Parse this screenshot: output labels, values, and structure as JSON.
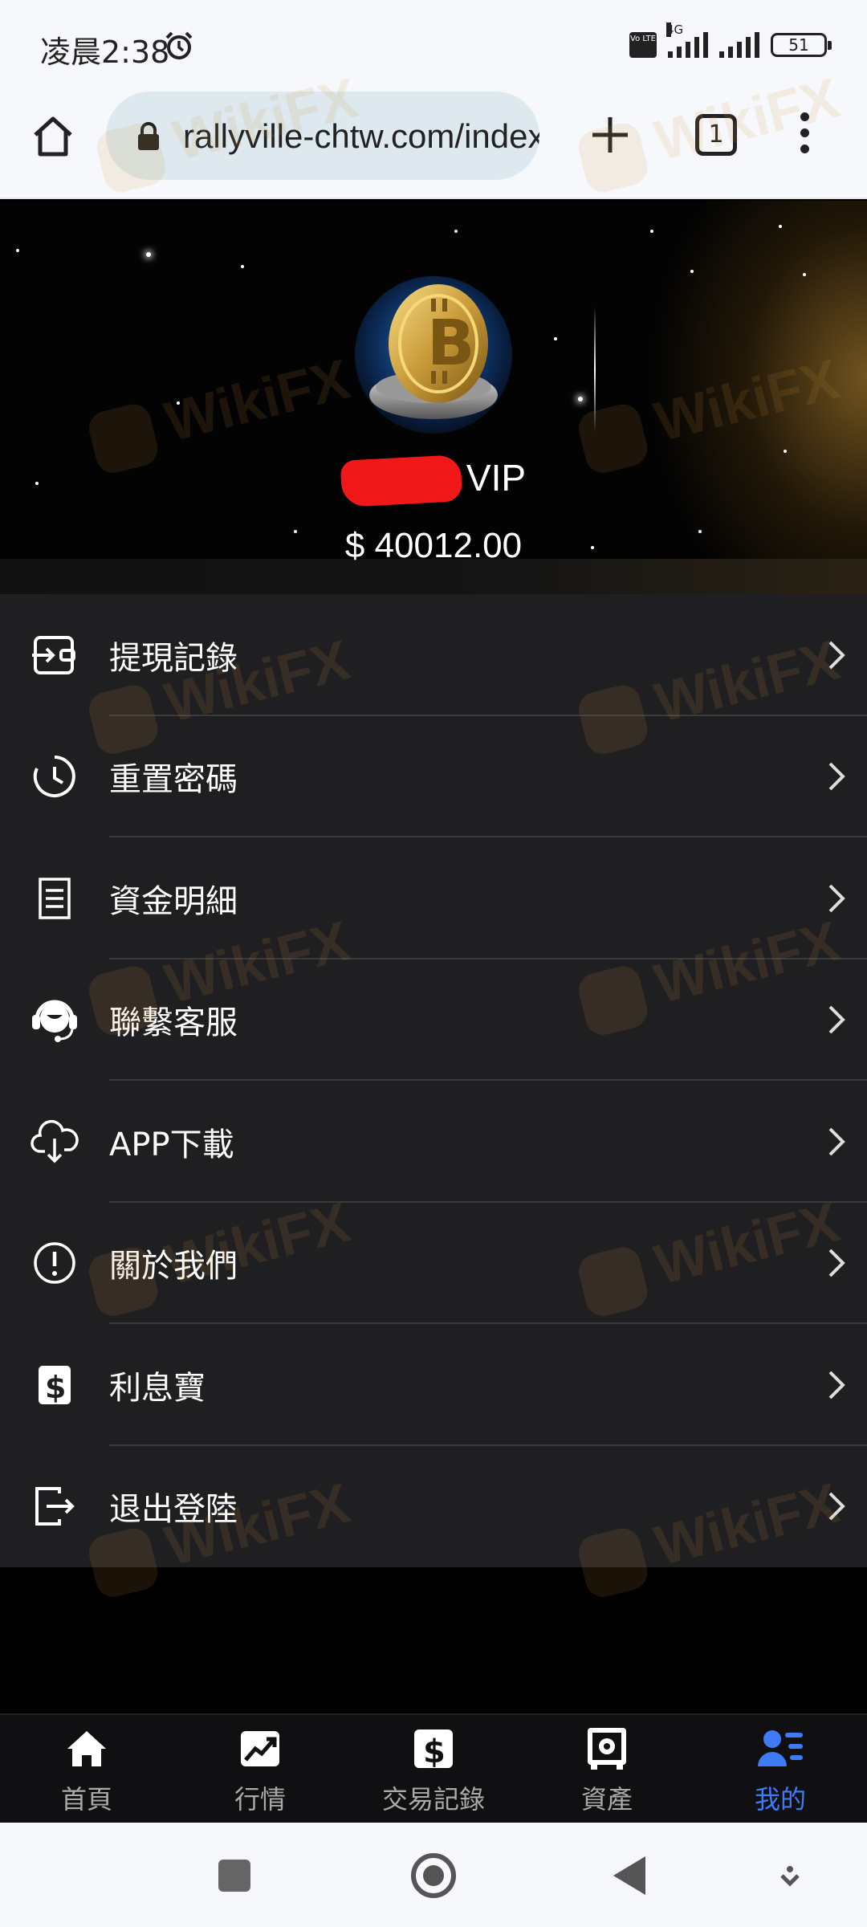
{
  "status_bar": {
    "time": "凌晨2:38",
    "network": "4G",
    "volte": "Vo LTE",
    "battery": "51"
  },
  "browser": {
    "url": "rallyville-chtw.com/index",
    "tab_count": "1"
  },
  "profile": {
    "username_suffix": "VIP",
    "balance": "$ 40012.00"
  },
  "menu": {
    "items": [
      {
        "label": "提現記錄",
        "icon": "withdraw-wallet-icon"
      },
      {
        "label": "重置密碼",
        "icon": "clock-reset-icon"
      },
      {
        "label": "資金明細",
        "icon": "document-list-icon"
      },
      {
        "label": "聯繫客服",
        "icon": "headset-support-icon"
      },
      {
        "label": "APP下載",
        "icon": "cloud-download-icon"
      },
      {
        "label": "關於我們",
        "icon": "info-exclamation-icon"
      },
      {
        "label": "利息寶",
        "icon": "dollar-bill-icon"
      },
      {
        "label": "退出登陸",
        "icon": "logout-icon"
      }
    ]
  },
  "bottom_nav": {
    "items": [
      {
        "label": "首頁",
        "icon": "home-icon"
      },
      {
        "label": "行情",
        "icon": "chart-trend-icon"
      },
      {
        "label": "交易記錄",
        "icon": "dollar-record-icon"
      },
      {
        "label": "資產",
        "icon": "safe-icon"
      },
      {
        "label": "我的",
        "icon": "user-list-icon"
      }
    ],
    "active_index": 4
  },
  "watermark": "WikiFX",
  "colors": {
    "accent_active": "#3f7bf5",
    "menu_bg": "#1f1f21",
    "censor_red": "#f01818"
  }
}
